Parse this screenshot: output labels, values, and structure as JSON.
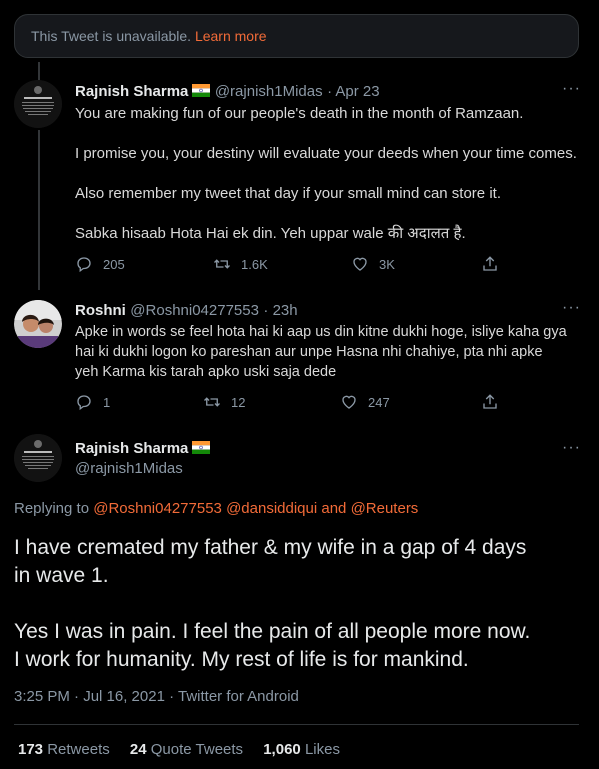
{
  "unavailable": {
    "text": "This Tweet is unavailable.",
    "link": "Learn more"
  },
  "tweet1": {
    "name": "Rajnish Sharma",
    "handle": "@rajnish1Midas",
    "date": "· Apr 23",
    "avatar_text": "Rajnish Sharma",
    "lines": [
      "You are making fun of our people's death in the month of Ramzaan.",
      "I promise you, your destiny will evaluate your deeds when your time comes.",
      "Also remember my tweet that day if your small mind can store it.",
      "Sabka hisaab Hota Hai ek din. Yeh uppar wale की अदालत है."
    ],
    "replies": "205",
    "retweets": "1.6K",
    "likes": "3K"
  },
  "tweet2": {
    "name": "Roshni",
    "handle": "@Roshni04277553",
    "date": "· 23h",
    "lines": [
      "Apke in words se feel hota hai ki aap us din kitne dukhi hoge, isliye kaha gya",
      "hai ki dukhi logon ko pareshan aur unpe Hasna nhi chahiye, pta nhi apke",
      "yeh Karma kis tarah apko uski saja dede"
    ],
    "replies": "1",
    "retweets": "12",
    "likes": "247"
  },
  "main": {
    "name": "Rajnish Sharma",
    "handle": "@rajnish1Midas",
    "avatar_text": "Rajnish Sharma",
    "replying_label": "Replying to",
    "mention1": "@Roshni04277553",
    "mention2": "@dansiddiqui",
    "and_label": "and",
    "mention3": "@Reuters",
    "lines": [
      "I have cremated my father & my wife in a gap of 4 days",
      "in wave 1.",
      "Yes I was in pain. I feel the pain of all people more now.",
      "I work for humanity. My rest of life is for mankind."
    ],
    "timestamp": "3:25 PM · Jul 16, 2021 · Twitter for Android",
    "retweets_count": "173",
    "retweets_label": "Retweets",
    "quotes_count": "24",
    "quotes_label": "Quote Tweets",
    "likes_count": "1,060",
    "likes_label": "Likes"
  },
  "icons": {
    "reply": "reply-icon",
    "retweet": "retweet-icon",
    "like": "heart-icon",
    "share": "share-icon",
    "more": "more-icon",
    "flag": "india-flag-icon"
  },
  "colors": {
    "accent": "#f26b38",
    "background": "#000000",
    "secondary_text": "#8b98a5"
  }
}
